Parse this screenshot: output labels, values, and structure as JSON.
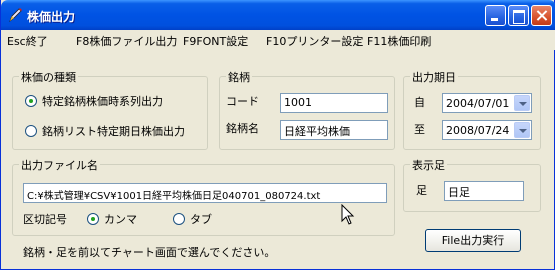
{
  "window": {
    "title": "株価出力"
  },
  "menu": [
    {
      "label": "Esc終了"
    },
    {
      "label": "F8株価ファイル出力"
    },
    {
      "label": "F9FONT設定"
    },
    {
      "label": "F10プリンター設定"
    },
    {
      "label": "F11株価印刷"
    }
  ],
  "stock_type": {
    "title": "株価の種類",
    "options": [
      {
        "label": "特定銘柄株価時系列出力",
        "selected": true
      },
      {
        "label": "銘柄リスト特定期日株価出力",
        "selected": false
      }
    ]
  },
  "brand": {
    "title": "銘柄",
    "code_label": "コード",
    "code_value": "1001",
    "name_label": "銘柄名",
    "name_value": "日経平均株価"
  },
  "period": {
    "title": "出力期日",
    "from_label": "自",
    "from_value": "2004/07/01",
    "to_label": "至",
    "to_value": "2008/07/24"
  },
  "output_file": {
    "title": "出力ファイル名",
    "path": "C:¥株式管理¥CSV¥1001日経平均株価日足040701_080724.txt",
    "delimiter_label": "区切記号",
    "delimiters": [
      {
        "label": "カンマ",
        "selected": true
      },
      {
        "label": "タブ",
        "selected": false
      }
    ]
  },
  "display_bar": {
    "title": "表示足",
    "label": "足",
    "value": "日足"
  },
  "hint": "銘柄・足を前以てチャート画面で選んでください。",
  "execute_button": "File出力実行",
  "colors": {
    "title_bar": "#0053E4",
    "face": "#ECE9D8",
    "frame": "#0831D9"
  }
}
